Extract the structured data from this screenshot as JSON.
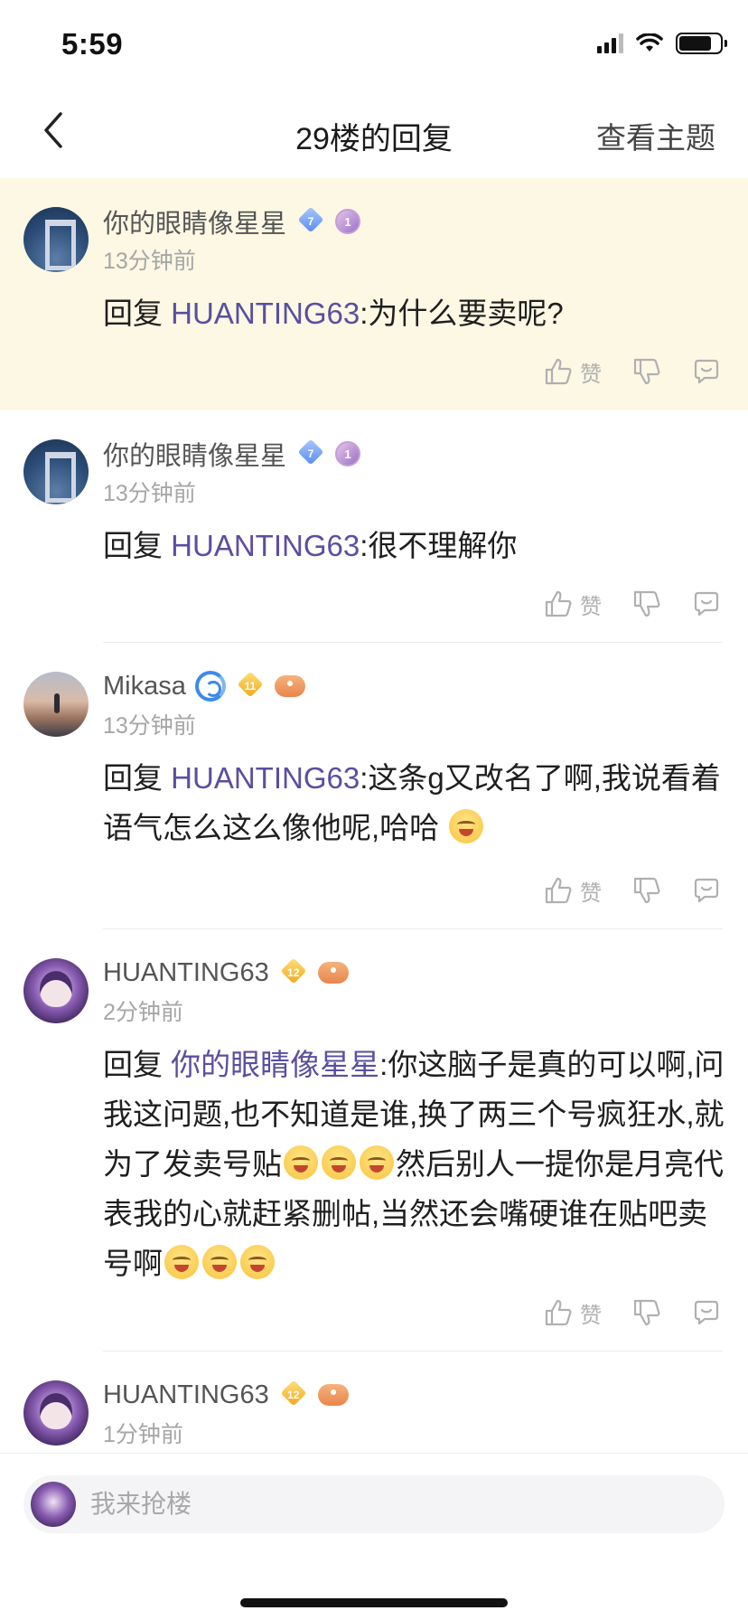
{
  "status_bar": {
    "time": "5:59"
  },
  "nav": {
    "title": "29楼的回复",
    "right_action": "查看主题"
  },
  "comments": [
    {
      "username": "你的眼睛像星星",
      "level": "7",
      "medal": "1",
      "time": "13分钟前",
      "reply_prefix": "回复",
      "reply_to": "HUANTING63",
      "text": ":为什么要卖呢?",
      "like_label": "赞"
    },
    {
      "username": "你的眼睛像星星",
      "level": "7",
      "medal": "1",
      "time": "13分钟前",
      "reply_prefix": "回复",
      "reply_to": "HUANTING63",
      "text": ":很不理解你",
      "like_label": "赞"
    },
    {
      "username": "Mikasa",
      "level": "11",
      "time": "13分钟前",
      "reply_prefix": "回复",
      "reply_to": "HUANTING63",
      "text": ":这条g又改名了啊,我说看着语气怎么这么像他呢,哈哈",
      "like_label": "赞"
    },
    {
      "username": "HUANTING63",
      "level": "12",
      "time": "2分钟前",
      "reply_prefix": "回复",
      "reply_to": "你的眼睛像星星",
      "text_a": ":你这脑子是真的可以啊,问我这问题,也不知道是谁,换了两三个号疯狂水,就为了发卖号贴",
      "text_b": "然后别人一提你是月亮代表我的心就赶紧删帖,当然还会嘴硬谁在贴吧卖号啊",
      "like_label": "赞"
    },
    {
      "username": "HUANTING63",
      "level": "12",
      "time": "1分钟前"
    }
  ],
  "bottom": {
    "placeholder": "我来抢楼"
  }
}
